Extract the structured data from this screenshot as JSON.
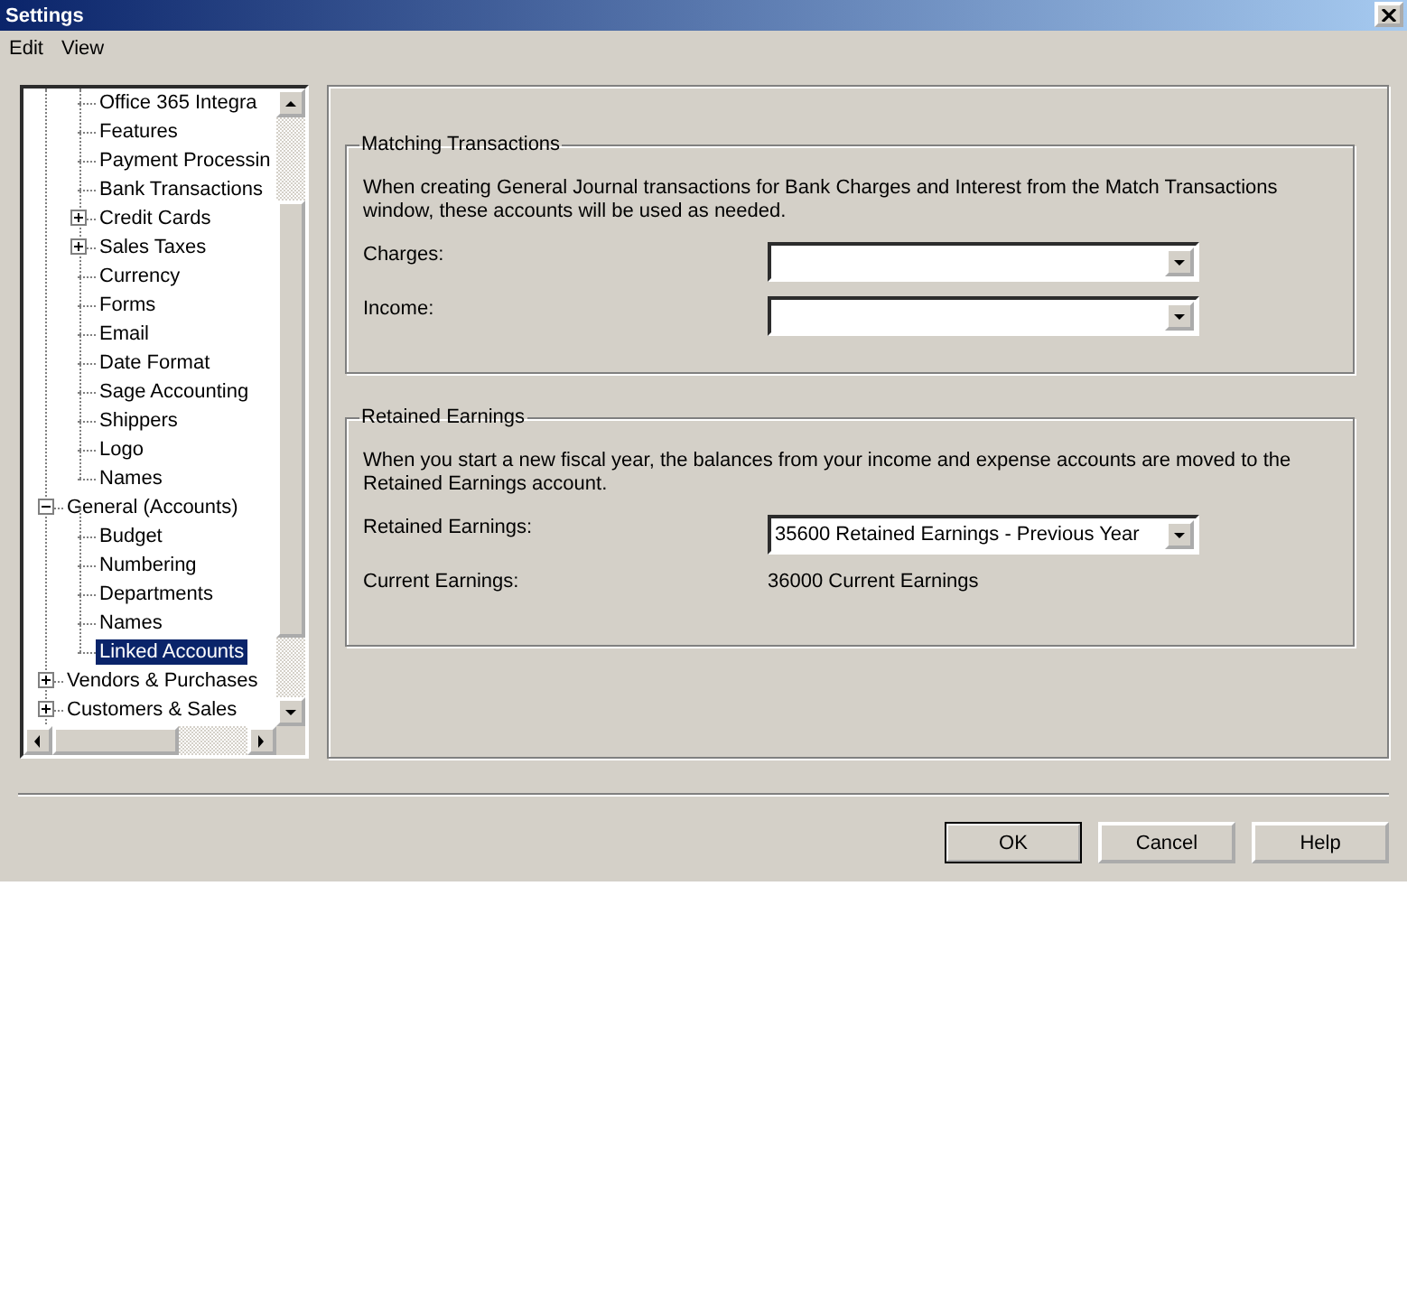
{
  "window": {
    "title": "Settings"
  },
  "menu": [
    "Edit",
    "View"
  ],
  "tree": {
    "items": [
      {
        "expanded": true,
        "children": [
          {
            "label": "Office 365 Integra",
            "selected": false
          },
          {
            "label": "Features",
            "selected": false
          },
          {
            "label": "Payment Processin",
            "selected": false
          },
          {
            "label": "Bank Transactions",
            "selected": false
          },
          {
            "label": "Credit Cards",
            "expanded": false,
            "selected": false
          },
          {
            "label": "Sales Taxes",
            "expanded": false,
            "selected": false
          },
          {
            "label": "Currency",
            "selected": false
          },
          {
            "label": "Forms",
            "selected": false
          },
          {
            "label": "Email",
            "selected": false
          },
          {
            "label": "Date Format",
            "selected": false
          },
          {
            "label": "Sage Accounting",
            "selected": false
          },
          {
            "label": "Shippers",
            "selected": false
          },
          {
            "label": "Logo",
            "selected": false
          },
          {
            "label": "Names",
            "selected": false
          }
        ]
      },
      {
        "label": "General (Accounts)",
        "expanded": true,
        "selected": false,
        "children": [
          {
            "label": "Budget",
            "selected": false
          },
          {
            "label": "Numbering",
            "selected": false
          },
          {
            "label": "Departments",
            "selected": false
          },
          {
            "label": "Names",
            "selected": false
          },
          {
            "label": "Linked Accounts",
            "selected": true
          }
        ]
      },
      {
        "label": "Vendors & Purchases",
        "expanded": false,
        "selected": false
      },
      {
        "label": "Customers & Sales",
        "expanded": false,
        "selected": false
      }
    ]
  },
  "groups": [
    {
      "title": "Matching Transactions",
      "description": "When creating General Journal transactions for Bank Charges and Interest from the Match Transactions window, these accounts will be used as needed.",
      "fields": [
        {
          "kind": "combo",
          "label": "Charges:"
        },
        {
          "kind": "combo",
          "label": "Income:"
        }
      ]
    },
    {
      "title": "Retained Earnings",
      "description": "When you start a new fiscal year, the balances from your income and expense accounts are moved to the Retained Earnings account.",
      "fields": [
        {
          "kind": "combo",
          "label": "Retained Earnings:",
          "value": "35600 Retained Earnings - Previous Year"
        },
        {
          "kind": "text",
          "label": "Current Earnings:",
          "value": "36000 Current Earnings"
        }
      ]
    }
  ],
  "buttons": [
    {
      "label": "OK",
      "default": true
    },
    {
      "label": "Cancel",
      "default": false
    },
    {
      "label": "Help",
      "default": false
    }
  ]
}
